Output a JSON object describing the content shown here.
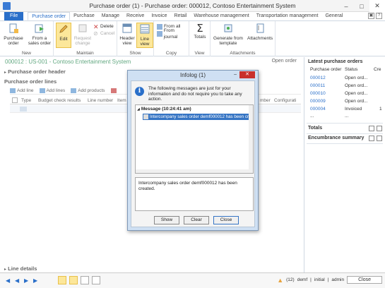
{
  "window": {
    "title": "Purchase order (1) - Purchase order: 000012, Contoso Entertainment System",
    "min": "–",
    "max": "□",
    "close": "✕"
  },
  "tabs": {
    "file": "File",
    "items": [
      "Purchase order",
      "Purchase",
      "Manage",
      "Receive",
      "Invoice",
      "Retail",
      "Warehouse management",
      "Transportation management",
      "General"
    ]
  },
  "ribbon": {
    "new": {
      "label": "New",
      "btn1": "Purchase order",
      "btn2": "From a sales order"
    },
    "maintain": {
      "label": "Maintain",
      "edit": "Edit",
      "request": "Request change",
      "delete": "Delete",
      "cancel": "Cancel"
    },
    "show": {
      "label": "Show",
      "header": "Header view",
      "line": "Line view"
    },
    "copy": {
      "label": "Copy",
      "fromall": "From all",
      "fromjournal": "From journal"
    },
    "view": {
      "label": "View",
      "totals": "Totals"
    },
    "attachments": {
      "label": "Attachments",
      "generate": "Generate from template",
      "attachments": "Attachments"
    }
  },
  "page": {
    "header": "000012 : US-001 - Contoso Entertainment System",
    "status": "Open order"
  },
  "sections": {
    "poheader": "Purchase order header",
    "polines": "Purchase order lines",
    "linedetails": "Line details"
  },
  "lines_toolbar": {
    "add_line": "Add line",
    "add_lines": "Add lines",
    "add_products": "Add products"
  },
  "grid": {
    "columns": [
      "Type",
      "Budget check results",
      "Line number",
      "Item"
    ],
    "more_cols": [
      "mber",
      "Configurati"
    ]
  },
  "right_pane": {
    "title": "Latest purchase orders",
    "headers": [
      "Purchase order",
      "Status",
      "Cre"
    ],
    "rows": [
      {
        "po": "000012",
        "status": "Open ord...",
        "cre": ""
      },
      {
        "po": "000011",
        "status": "Open ord...",
        "cre": ""
      },
      {
        "po": "000010",
        "status": "Open ord...",
        "cre": ""
      },
      {
        "po": "000009",
        "status": "Open ord...",
        "cre": ""
      },
      {
        "po": "000004",
        "status": "Invoiced",
        "cre": "1"
      }
    ],
    "ellipsis": "...",
    "totals": "Totals",
    "encumbrance": "Encumbrance summary"
  },
  "dialog": {
    "title": "Infolog (1)",
    "min": "–",
    "close": "✕",
    "message": "The following messages are just for your information and do not require you to take any action.",
    "tree_header": "Message (10:24:41 am)",
    "tree_row": "Intercompany sales order demf000012 has been cre",
    "detail": "Intercompany sales order demf000012 has been created.",
    "btn_show": "Show",
    "btn_clear": "Clear",
    "btn_close": "Close"
  },
  "statusbar": {
    "notif": "(12)",
    "company": "demf",
    "layer": "initial",
    "user": "admin",
    "close": "Close"
  }
}
